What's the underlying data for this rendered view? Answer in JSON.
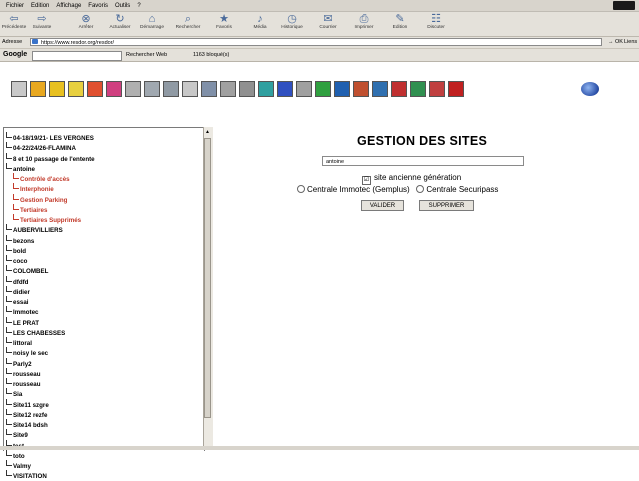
{
  "browser": {
    "menu": [
      "Fichier",
      "Edition",
      "Affichage",
      "Favoris",
      "Outils",
      "?"
    ],
    "toolbar": [
      {
        "label": "Précédente",
        "icon": "back-arrow-icon"
      },
      {
        "label": "Suivante",
        "icon": "forward-arrow-icon"
      },
      {
        "label": "Arrêter",
        "icon": "stop-icon"
      },
      {
        "label": "Actualiser",
        "icon": "refresh-icon"
      },
      {
        "label": "Démarrage",
        "icon": "home-icon"
      },
      {
        "label": "Rechercher",
        "icon": "search-icon"
      },
      {
        "label": "Favoris",
        "icon": "favorites-icon"
      },
      {
        "label": "Média",
        "icon": "media-icon"
      },
      {
        "label": "Historique",
        "icon": "history-icon"
      },
      {
        "label": "Courrier",
        "icon": "mail-icon"
      },
      {
        "label": "Imprimer",
        "icon": "print-icon"
      },
      {
        "label": "Edition",
        "icon": "edit-icon"
      },
      {
        "label": "Discuter",
        "icon": "discuss-icon"
      }
    ],
    "address_label": "Adresse",
    "address_url": "https://www.resdor.org/resdor/",
    "go_label": "OK",
    "links_label": "Liens",
    "google_label": "Google",
    "google_search_label": "Rechercher Web",
    "blocked_label": "1163 bloqué(s)"
  },
  "app_icons": [
    "#c9c9c9",
    "#e8a820",
    "#e8c020",
    "#e8d040",
    "#e05030",
    "#d04080",
    "#b0b0b0",
    "#a0a8b0",
    "#909aa4",
    "#c8c8c8",
    "#8090a8",
    "#a0a0a0",
    "#909090",
    "#30a0a0",
    "#3050c0",
    "#a0a0a0",
    "#30a040",
    "#2060b0",
    "#c05030",
    "#3070b0",
    "#c03030",
    "#309050",
    "#c04040",
    "#c02020"
  ],
  "tree": {
    "items": [
      {
        "label": "04-18/19/21- LES VERGNES",
        "child": false
      },
      {
        "label": "04-22/24/26-FLAMINA",
        "child": false
      },
      {
        "label": "8 et 10 passage de l'entente",
        "child": false
      },
      {
        "label": "antoine",
        "child": false
      },
      {
        "label": "Contrôle d'accès",
        "child": true
      },
      {
        "label": "Interphonie",
        "child": true
      },
      {
        "label": "Gestion Parking",
        "child": true
      },
      {
        "label": "Tertiaires",
        "child": true
      },
      {
        "label": "Tertiaires Supprimés",
        "child": true
      },
      {
        "label": "AUBERVILLIERS",
        "child": false
      },
      {
        "label": "bezons",
        "child": false
      },
      {
        "label": "bold",
        "child": false
      },
      {
        "label": "coco",
        "child": false
      },
      {
        "label": "COLOMBEL",
        "child": false
      },
      {
        "label": "dfdfd",
        "child": false
      },
      {
        "label": "didier",
        "child": false
      },
      {
        "label": "essai",
        "child": false
      },
      {
        "label": "Immotec",
        "child": false
      },
      {
        "label": "LE PRAT",
        "child": false
      },
      {
        "label": "LES CHABESSES",
        "child": false
      },
      {
        "label": "littoral",
        "child": false
      },
      {
        "label": "noisy le sec",
        "child": false
      },
      {
        "label": "Parly2",
        "child": false
      },
      {
        "label": "rousseau",
        "child": false
      },
      {
        "label": "rousseau",
        "child": false
      },
      {
        "label": "Sia",
        "child": false
      },
      {
        "label": "Site11 szgre",
        "child": false
      },
      {
        "label": "Site12 rezfe",
        "child": false
      },
      {
        "label": "Site14 bdsh",
        "child": false
      },
      {
        "label": "Site9",
        "child": false
      },
      {
        "label": "test",
        "child": false
      },
      {
        "label": "toto",
        "child": false
      },
      {
        "label": "Valmy",
        "child": false
      },
      {
        "label": "VISITATION",
        "child": false
      }
    ]
  },
  "form": {
    "title": "GESTION DES SITES",
    "name_value": "antoine",
    "checkbox_label": "site ancienne génération",
    "checkbox_checked": true,
    "radio1_label": "Centrale Immotec (Gemplus)",
    "radio2_label": "Centrale Securipass",
    "validate_label": "VALIDER",
    "delete_label": "SUPPRIMER"
  }
}
